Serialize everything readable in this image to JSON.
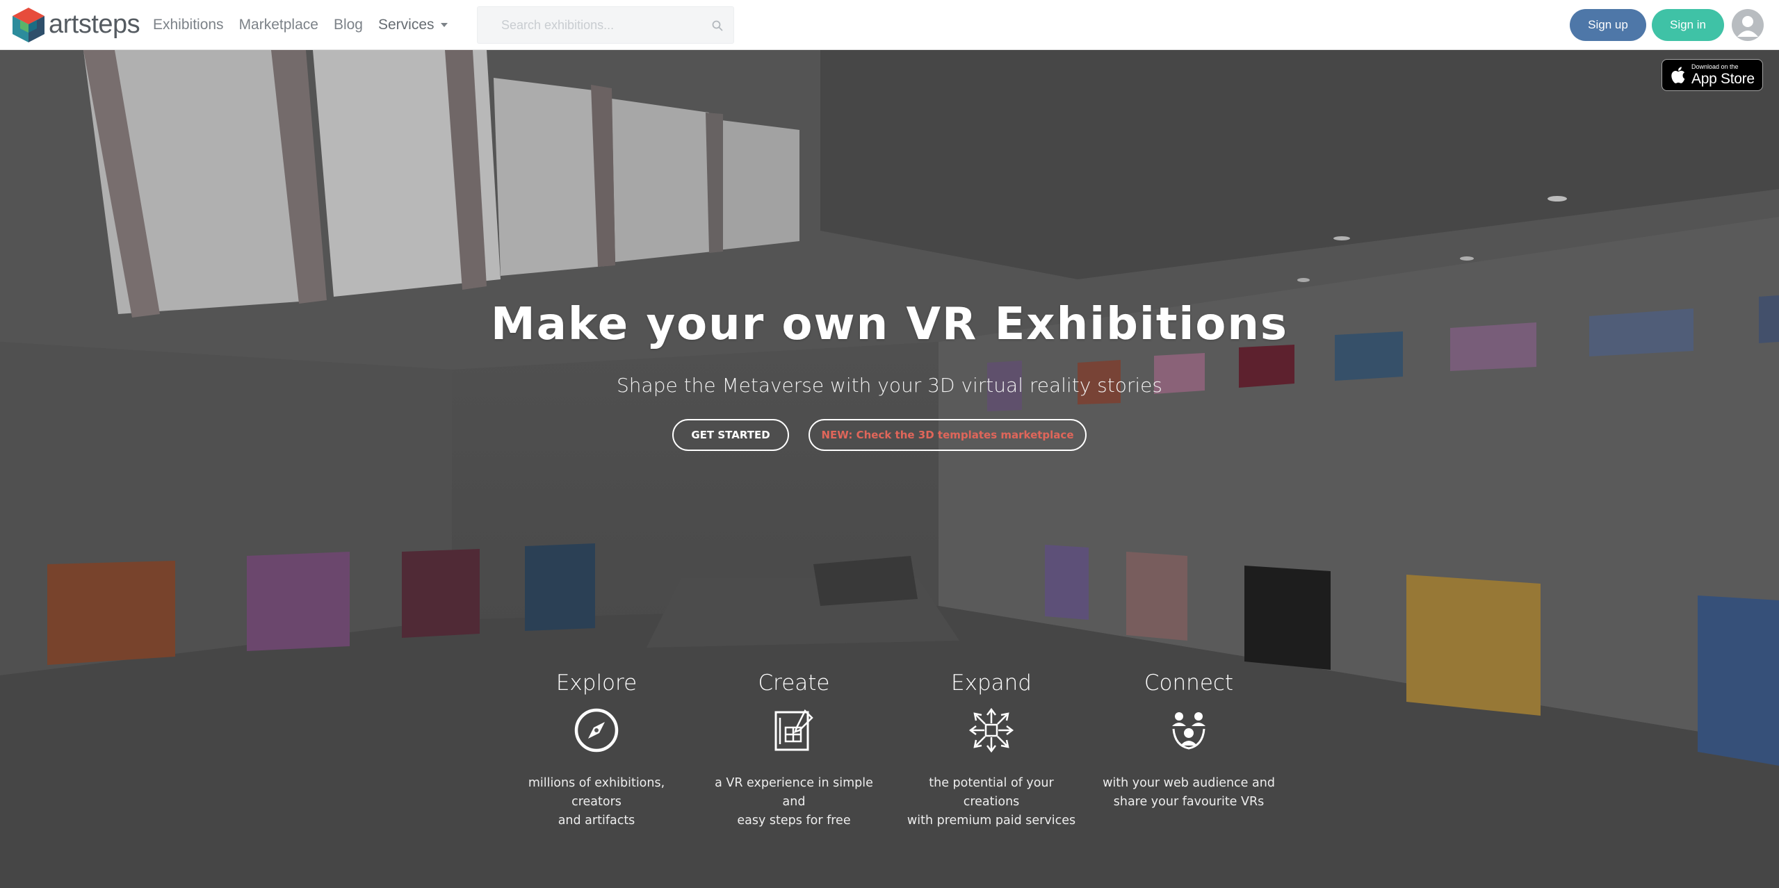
{
  "brand": {
    "name": "artsteps"
  },
  "nav": {
    "links": [
      {
        "label": "Exhibitions"
      },
      {
        "label": "Marketplace"
      },
      {
        "label": "Blog"
      },
      {
        "label": "Services"
      }
    ],
    "search_placeholder": "Search exhibitions...",
    "signup_label": "Sign up",
    "signin_label": "Sign in"
  },
  "appstore": {
    "small_text": "Download on the",
    "big_text": "App Store"
  },
  "hero": {
    "title": "Make your own VR Exhibitions",
    "subtitle": "Shape the Metaverse with your 3D virtual reality stories",
    "cta_primary": "GET STARTED",
    "cta_secondary": "NEW: Check the 3D templates marketplace"
  },
  "features": [
    {
      "title": "Explore",
      "icon": "compass-icon",
      "desc_line1": "millions of exhibitions, creators",
      "desc_line2": "and artifacts"
    },
    {
      "title": "Create",
      "icon": "blueprint-pen-icon",
      "desc_line1": "a VR experience in simple and",
      "desc_line2": "easy steps for free"
    },
    {
      "title": "Expand",
      "icon": "expand-arrows-icon",
      "desc_line1": "the potential of your creations",
      "desc_line2": "with premium paid services"
    },
    {
      "title": "Connect",
      "icon": "people-network-icon",
      "desc_line1": "with your web audience and",
      "desc_line2": "share your favourite VRs"
    }
  ],
  "colors": {
    "signup_bg": "#4e77a8",
    "signin_bg": "#3fc2a6",
    "marketplace_cta_text": "#e0665a",
    "nav_text": "#7c8288"
  }
}
